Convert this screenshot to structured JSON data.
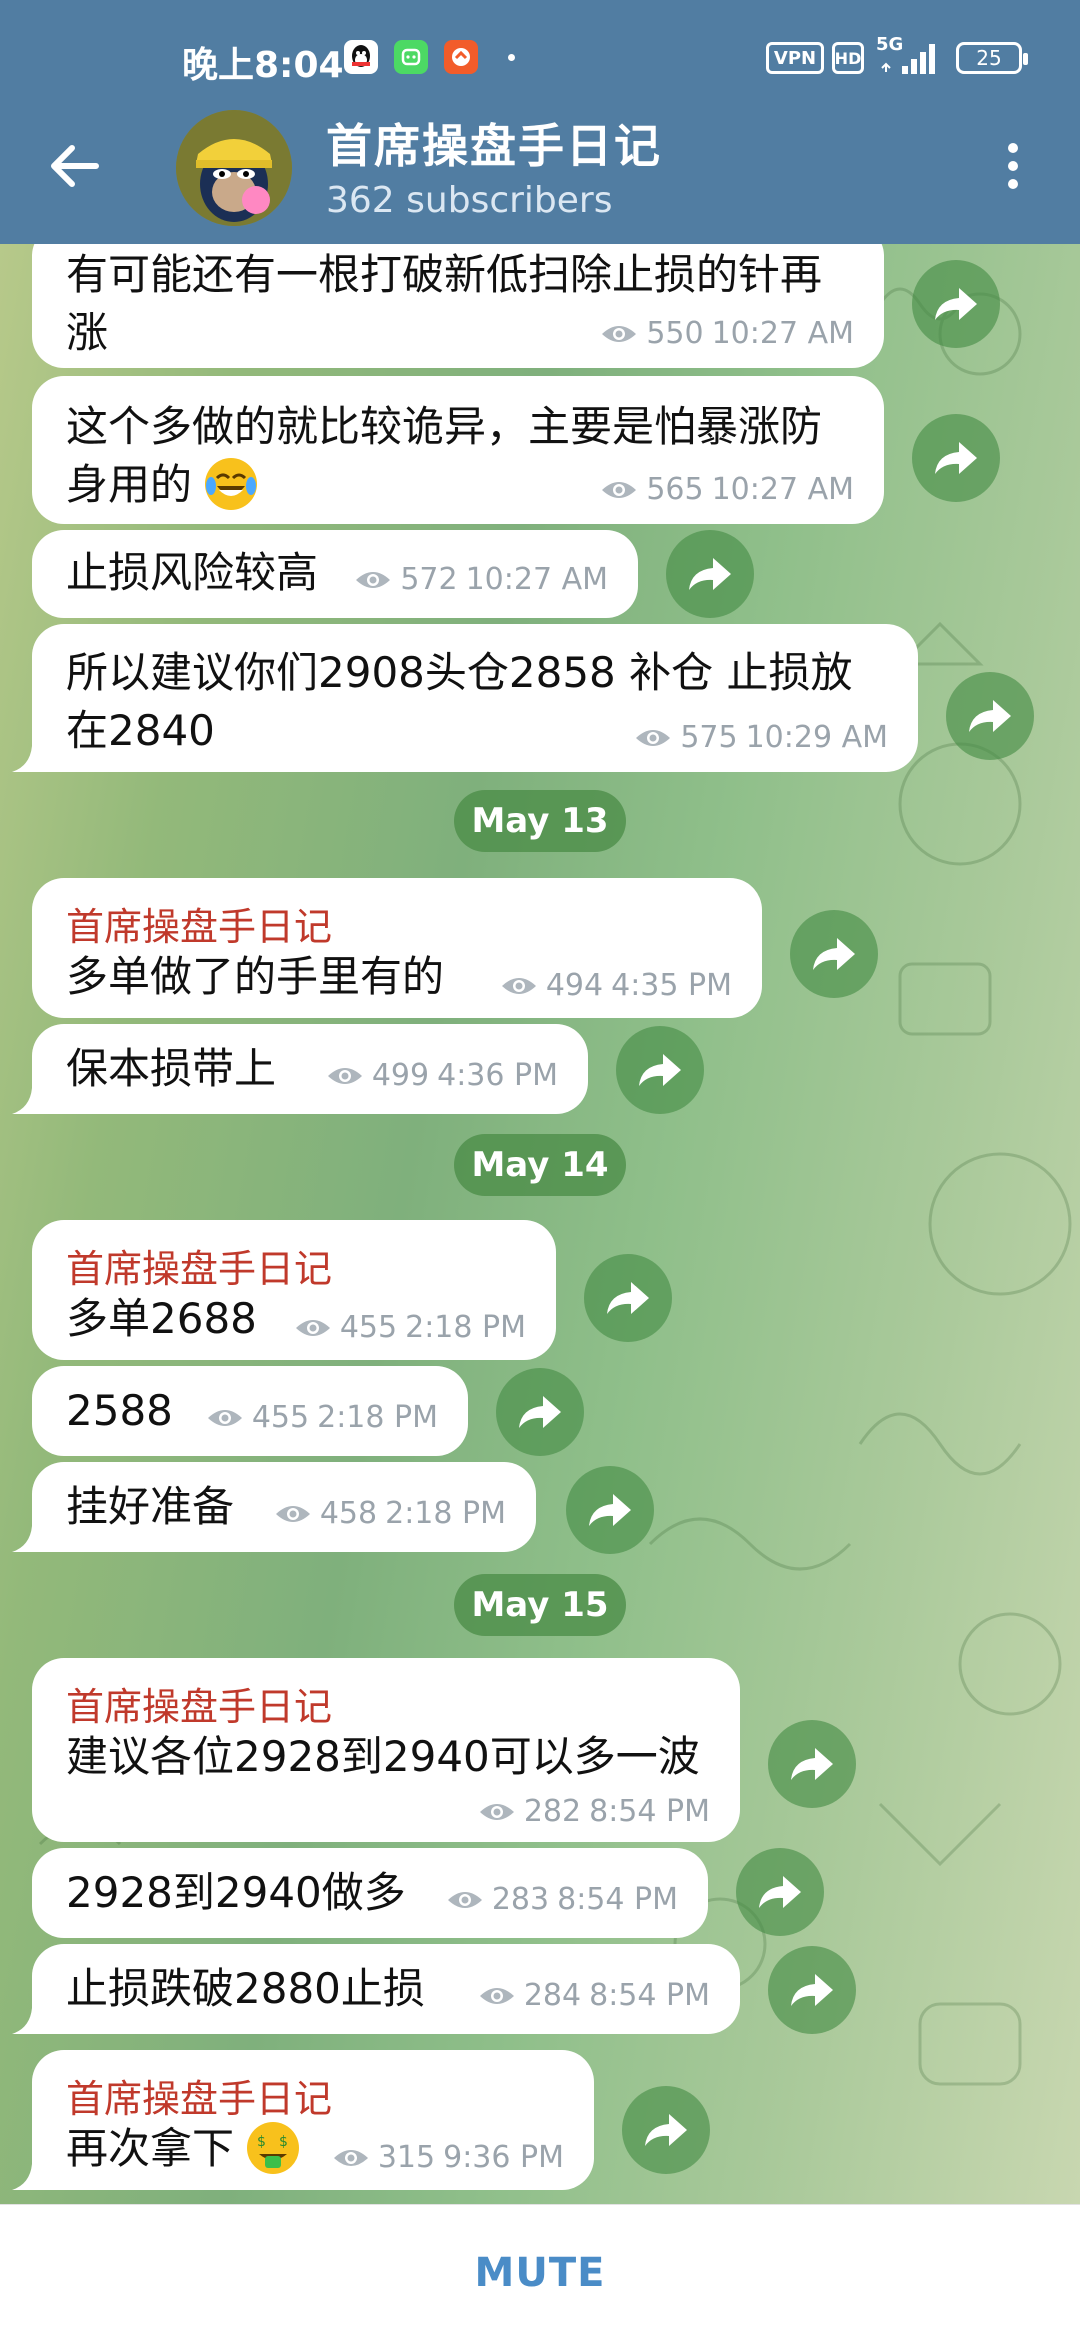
{
  "status_bar": {
    "time": "晚上8:04",
    "vpn": "VPN",
    "hd": "HD",
    "network": "5G",
    "battery": "25"
  },
  "header": {
    "title": "首席操盘手日记",
    "subtitle": "362 subscribers"
  },
  "messages": [
    {
      "lines": [
        "有可能还有一根打破新低扫除止损的针再",
        "涨"
      ],
      "views": "550",
      "time": "10:27 AM"
    },
    {
      "lines": [
        "这个多做的就比较诡异，主要是怕暴涨防",
        "身用的"
      ],
      "emoji": "face-with-tears-of-joy",
      "views": "565",
      "time": "10:27 AM"
    },
    {
      "lines": [
        "止损风险较高"
      ],
      "views": "572",
      "time": "10:27 AM"
    },
    {
      "lines": [
        "所以建议你们2908头仓2858  补仓 止损放",
        "在2840"
      ],
      "views": "575",
      "time": "10:29 AM"
    },
    {
      "date": "May 13"
    },
    {
      "sender": "首席操盘手日记",
      "lines": [
        "多单做了的手里有的"
      ],
      "views": "494",
      "time": "4:35 PM"
    },
    {
      "lines": [
        "保本损带上"
      ],
      "views": "499",
      "time": "4:36 PM"
    },
    {
      "date": "May 14"
    },
    {
      "sender": "首席操盘手日记",
      "lines": [
        "多单2688"
      ],
      "views": "455",
      "time": "2:18 PM"
    },
    {
      "lines": [
        "2588"
      ],
      "views": "455",
      "time": "2:18 PM"
    },
    {
      "lines": [
        "挂好准备"
      ],
      "views": "458",
      "time": "2:18 PM"
    },
    {
      "date": "May 15"
    },
    {
      "sender": "首席操盘手日记",
      "lines": [
        "建议各位2928到2940可以多一波"
      ],
      "views": "282",
      "time": "8:54 PM"
    },
    {
      "lines": [
        "2928到2940做多"
      ],
      "views": "283",
      "time": "8:54 PM"
    },
    {
      "lines": [
        "止损跌破2880止损"
      ],
      "views": "284",
      "time": "8:54 PM"
    },
    {
      "sender": "首席操盘手日记",
      "lines": [
        "再次拿下"
      ],
      "emoji": "money-mouth-face",
      "views": "315",
      "time": "9:36 PM"
    }
  ],
  "bottom_bar": {
    "action": "MUTE"
  },
  "colors": {
    "header": "#517da2",
    "sender": "#c0392b",
    "mute": "#4a8cc7",
    "date_pill": "#4c8d48"
  }
}
